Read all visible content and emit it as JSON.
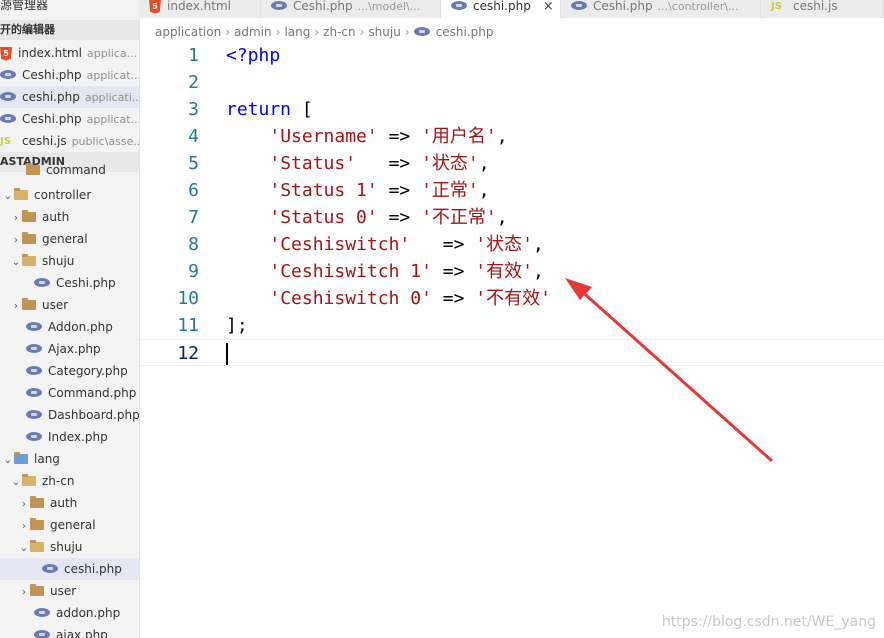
{
  "sidebar": {
    "title": "源管理器",
    "open_editors_header": "开的编辑器",
    "open_editors": [
      {
        "icon": "html5-icon",
        "name": "index.html",
        "desc": "applica...",
        "active": false
      },
      {
        "icon": "php-icon",
        "name": "Ceshi.php",
        "desc": "applicat...",
        "active": false
      },
      {
        "icon": "php-icon",
        "name": "ceshi.php",
        "desc": "applicati...",
        "active": true
      },
      {
        "icon": "php-icon",
        "name": "Ceshi.php",
        "desc": "applicat...",
        "active": false
      },
      {
        "icon": "js-icon",
        "name": "ceshi.js",
        "desc": "public\\asse...",
        "active": false
      }
    ],
    "project_header": "ASTADMIN",
    "tree": [
      {
        "label": "command",
        "type": "folder"
      },
      {
        "label": "controller",
        "type": "folder-open"
      },
      {
        "label": "auth",
        "type": "folder"
      },
      {
        "label": "general",
        "type": "folder"
      },
      {
        "label": "shuju",
        "type": "folder-open"
      },
      {
        "label": "Ceshi.php",
        "type": "php"
      },
      {
        "label": "user",
        "type": "folder"
      },
      {
        "label": "Addon.php",
        "type": "php"
      },
      {
        "label": "Ajax.php",
        "type": "php"
      },
      {
        "label": "Category.php",
        "type": "php"
      },
      {
        "label": "Command.php",
        "type": "php"
      },
      {
        "label": "Dashboard.php",
        "type": "php"
      },
      {
        "label": "Index.php",
        "type": "php"
      },
      {
        "label": "lang",
        "type": "folder-open-blue"
      },
      {
        "label": "zh-cn",
        "type": "folder-open"
      },
      {
        "label": "auth",
        "type": "folder"
      },
      {
        "label": "general",
        "type": "folder"
      },
      {
        "label": "shuju",
        "type": "folder-open"
      },
      {
        "label": "ceshi.php",
        "type": "php",
        "active": true
      },
      {
        "label": "user",
        "type": "folder"
      },
      {
        "label": "addon.php",
        "type": "php"
      },
      {
        "label": "ajax.php",
        "type": "php"
      }
    ]
  },
  "tabs": [
    {
      "icon": "html5-icon",
      "name": "index.html",
      "desc": ""
    },
    {
      "icon": "php-icon",
      "name": "Ceshi.php",
      "desc": "...\\model\\..."
    },
    {
      "icon": "php-icon",
      "name": "ceshi.php",
      "desc": "",
      "active": true,
      "close": "×"
    },
    {
      "icon": "php-icon",
      "name": "Ceshi.php",
      "desc": "...\\controller\\..."
    },
    {
      "icon": "js-icon",
      "name": "ceshi.js",
      "desc": ""
    }
  ],
  "breadcrumb": [
    "application",
    "admin",
    "lang",
    "zh-cn",
    "shuju",
    "ceshi.php"
  ],
  "code_lines": [
    {
      "n": "1",
      "text": "<?php"
    },
    {
      "n": "2",
      "text": ""
    },
    {
      "n": "3",
      "text": "return ["
    },
    {
      "n": "4",
      "text": "    'Username' => '用户名',"
    },
    {
      "n": "5",
      "text": "    'Status'   => '状态',"
    },
    {
      "n": "6",
      "text": "    'Status 1' => '正常',"
    },
    {
      "n": "7",
      "text": "    'Status 0' => '不正常',"
    },
    {
      "n": "8",
      "text": "    'Ceshiswitch'   => '状态',"
    },
    {
      "n": "9",
      "text": "    'Ceshiswitch 1' => '有效',"
    },
    {
      "n": "10",
      "text": "    'Ceshiswitch 0' => '不有效'"
    },
    {
      "n": "11",
      "text": "];"
    },
    {
      "n": "12",
      "text": ""
    }
  ],
  "watermark": "https://blog.csdn.net/WE_yang",
  "colors": {
    "keyword": "#0000ff",
    "string": "#a31515",
    "line_number": "#237893",
    "arrow": "#e53935"
  }
}
